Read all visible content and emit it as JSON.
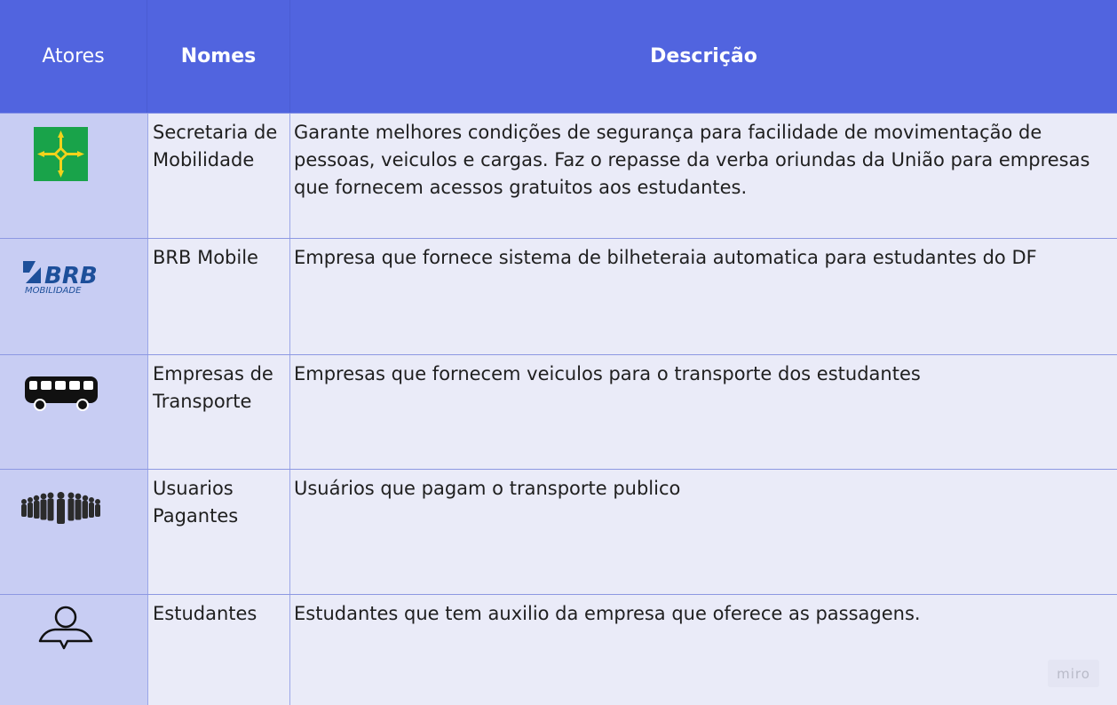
{
  "header": {
    "col_actors": "Atores",
    "col_names": "Nomes",
    "col_description": "Descrição"
  },
  "rows": [
    {
      "icon": "df-flag-icon",
      "name": "Secretaria de Mobilidade",
      "description": "Garante melhores condições de segurança para facilidade de movimentação de pessoas, veiculos e cargas. Faz o repasse da verba oriundas da União para empresas que fornecem acessos gratuitos aos estudantes."
    },
    {
      "icon": "brb-logo-icon",
      "logo_text": "BRB",
      "logo_subtext": "MOBILIDADE",
      "name": "BRB Mobile",
      "description": "Empresa que fornece sistema de bilheteraia automatica para estudantes do DF"
    },
    {
      "icon": "bus-icon",
      "name": "Empresas de Transporte",
      "description": "Empresas que fornecem veiculos para o transporte dos estudantes"
    },
    {
      "icon": "crowd-icon",
      "name": "Usuarios Pagantes",
      "description": "Usuários que pagam o transporte publico"
    },
    {
      "icon": "user-icon",
      "name": "Estudantes",
      "description": "Estudantes que tem auxilio da empresa que oferece as passagens."
    }
  ],
  "watermark": "miro",
  "colors": {
    "header": "#5164df",
    "actor_column": "#c8cdf3",
    "body": "#eaebf8",
    "flag_green": "#19a34a",
    "flag_yellow": "#f3d21b",
    "brb_blue": "#1d4f9a"
  }
}
